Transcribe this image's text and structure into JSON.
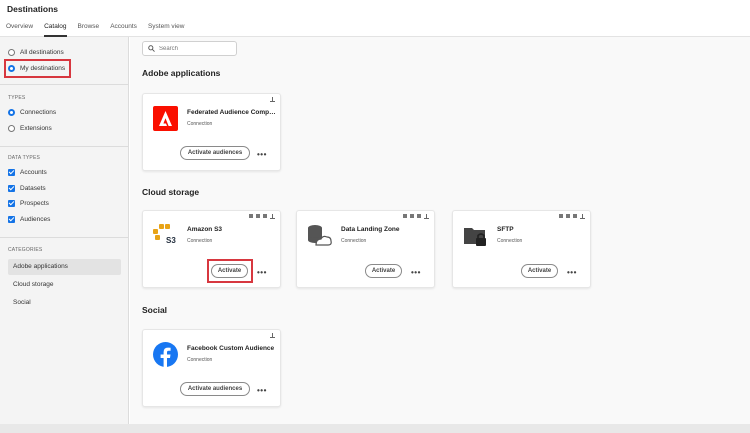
{
  "app": {
    "title": "Destinations"
  },
  "tabs": [
    {
      "label": "Overview",
      "active": false
    },
    {
      "label": "Catalog",
      "active": true
    },
    {
      "label": "Browse",
      "active": false
    },
    {
      "label": "Accounts",
      "active": false
    },
    {
      "label": "System view",
      "active": false
    }
  ],
  "sidebar": {
    "scope": [
      {
        "label": "All destinations",
        "checked": false
      },
      {
        "label": "My destinations",
        "checked": true
      }
    ],
    "types": {
      "heading": "TYPES",
      "options": [
        {
          "label": "Connections",
          "checked": true
        },
        {
          "label": "Extensions",
          "checked": false
        }
      ]
    },
    "data_types": {
      "heading": "DATA TYPES",
      "options": [
        {
          "label": "Accounts",
          "checked": true
        },
        {
          "label": "Datasets",
          "checked": true
        },
        {
          "label": "Prospects",
          "checked": true
        },
        {
          "label": "Audiences",
          "checked": true
        }
      ]
    },
    "categories": {
      "heading": "CATEGORIES",
      "items": [
        {
          "label": "Adobe applications",
          "active": true
        },
        {
          "label": "Cloud storage",
          "active": false
        },
        {
          "label": "Social",
          "active": false
        }
      ]
    }
  },
  "search": {
    "placeholder": "Search"
  },
  "sections": {
    "adobe": {
      "title": "Adobe applications",
      "cards": [
        {
          "name": "Federated Audience Composit...",
          "type": "Connection",
          "action": "Activate audiences",
          "more": "•••",
          "logo": "adobe-logo"
        }
      ]
    },
    "cloud": {
      "title": "Cloud storage",
      "cards": [
        {
          "name": "Amazon S3",
          "type": "Connection",
          "action": "Activate",
          "more": "•••",
          "logo": "amazon-s3-logo",
          "logo_text": "S3"
        },
        {
          "name": "Data Landing Zone",
          "type": "Connection",
          "action": "Activate",
          "more": "•••",
          "logo": "data-landing-zone-logo"
        },
        {
          "name": "SFTP",
          "type": "Connection",
          "action": "Activate",
          "more": "•••",
          "logo": "sftp-logo"
        }
      ]
    },
    "social": {
      "title": "Social",
      "cards": [
        {
          "name": "Facebook Custom Audience",
          "type": "Connection",
          "action": "Activate audiences",
          "more": "•••",
          "logo": "facebook-logo"
        }
      ]
    }
  },
  "colors": {
    "accent": "#1473e6",
    "highlight": "#d7373f",
    "adobe_red": "#fa0f00",
    "facebook_blue": "#1877f2"
  }
}
